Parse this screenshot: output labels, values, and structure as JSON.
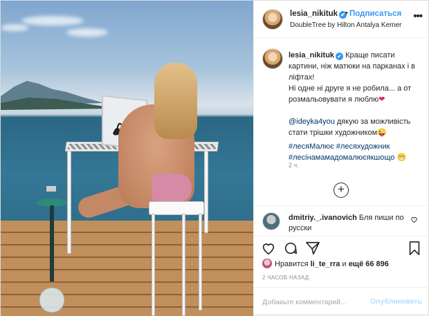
{
  "post": {
    "username": "lesia_nikituk",
    "verified_mark": "✔",
    "follow_label": "Подписаться",
    "separator": "•",
    "location": "DoubleTree by Hilton Antalya Kemer",
    "more_label": "•••"
  },
  "caption": {
    "username": "lesia_nikituk",
    "line1": " Краще писати картини, ніж матюки на парканах і в ліфтах!",
    "line2": "Ні одне ні друге я не робила... а от розмальовувати я люблю",
    "line2_emoji": "❤",
    "mention": "@ideyka4you",
    "line3": " дякую за можливість стати трішки художником",
    "line3_emoji": "😜",
    "hashtags_line1": "#лесяМалює #лесяхудожник",
    "hashtags_line2": "#лесінамамадомалюєякшощо",
    "hashtags_emoji": "😁",
    "time_ago": "2 ч.",
    "load_more": "+"
  },
  "comment": {
    "username": "dmitriy._.ivanovich",
    "text": " Бля пиши по русски"
  },
  "actions": {
    "like_icon": "heart-outline-icon",
    "comment_icon": "comment-icon",
    "share_icon": "paper-plane-icon",
    "save_icon": "bookmark-icon"
  },
  "likes": {
    "prefix": "Нравится ",
    "liker": "li_te_rra",
    "middle": " и ",
    "count": "ещё 66 896"
  },
  "posted_label": "2 ЧАСОВ НАЗАД",
  "add_comment": {
    "placeholder": "Добавьте комментарий...",
    "publish_label": "Опубликовать"
  },
  "colors": {
    "accent_blue": "#3897f0",
    "link_dark": "#003569",
    "muted": "#8e8e8e",
    "border": "#efefef"
  }
}
